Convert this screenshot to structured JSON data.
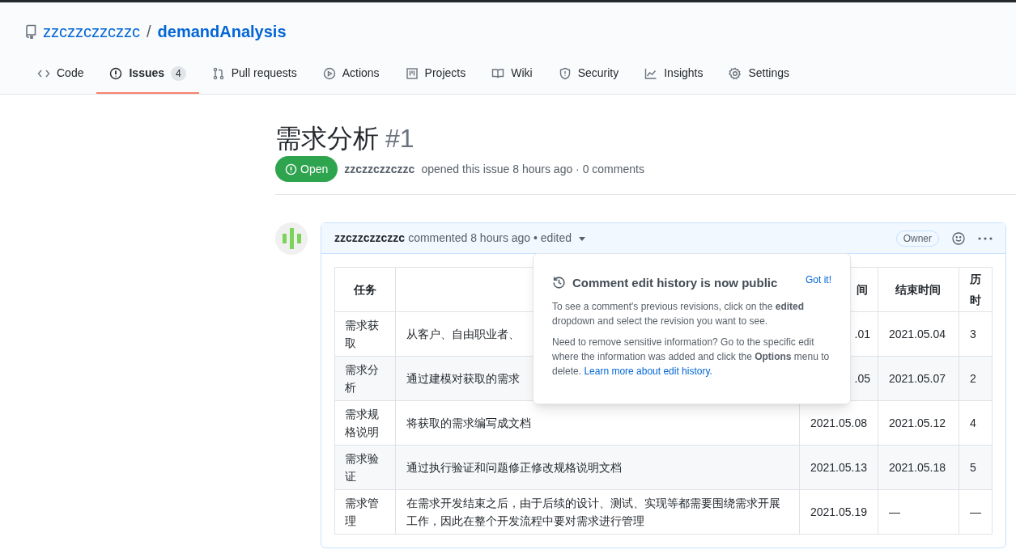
{
  "repo": {
    "owner": "zzczzczzczzc",
    "separator": "/",
    "name": "demandAnalysis"
  },
  "tabs": [
    {
      "label": "Code",
      "selected": false
    },
    {
      "label": "Issues",
      "selected": true,
      "counter": "4"
    },
    {
      "label": "Pull requests",
      "selected": false
    },
    {
      "label": "Actions",
      "selected": false
    },
    {
      "label": "Projects",
      "selected": false
    },
    {
      "label": "Wiki",
      "selected": false
    },
    {
      "label": "Security",
      "selected": false
    },
    {
      "label": "Insights",
      "selected": false
    },
    {
      "label": "Settings",
      "selected": false
    }
  ],
  "issue": {
    "title": "需求分析",
    "number": "#1",
    "state": "Open",
    "author": "zzczzczzczzc",
    "meta": "opened this issue 8 hours ago · 0 comments"
  },
  "comment": {
    "author": "zzczzczzczzc",
    "meta": "commented 8 hours ago • edited",
    "badge": "Owner",
    "table": {
      "columns": [
        "任务",
        null,
        "间",
        "结束时间",
        "历时"
      ],
      "rows": [
        [
          "需求获取",
          "从客户、自由职业者、",
          ".01",
          "2021.05.04",
          "3"
        ],
        [
          "需求分析",
          "通过建模对获取的需求",
          ".05",
          "2021.05.07",
          "2"
        ],
        [
          "需求规格说明",
          "将获取的需求编写成文档",
          "2021.05.08",
          "2021.05.12",
          "4"
        ],
        [
          "需求验证",
          "通过执行验证和问题修正修改规格说明文档",
          "2021.05.13",
          "2021.05.18",
          "5"
        ],
        [
          "需求管理",
          "在需求开发结束之后，由于后续的设计、测试、实现等都需要围绕需求开展工作，因此在整个开发流程中要对需求进行管理",
          "2021.05.19",
          "—",
          "—"
        ]
      ]
    }
  },
  "popover": {
    "title": "Comment edit history is now public",
    "dismiss": "Got it!",
    "paragraphs": [
      {
        "text": "To see a comment's previous revisions, click on the **edited** dropdown and select the revision you want to see."
      },
      {
        "text": "Need to remove sensitive information? Go to the specific edit where the information was added and click the **Options** menu to delete.",
        "link": "Learn more about edit history."
      }
    ]
  }
}
